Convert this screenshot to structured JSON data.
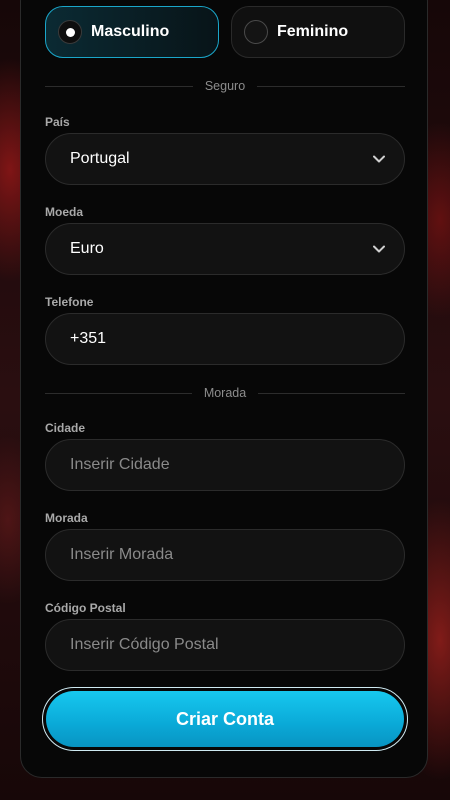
{
  "gender": {
    "male_label": "Masculino",
    "female_label": "Feminino",
    "selected": "Masculino"
  },
  "sections": {
    "insurance": "Seguro",
    "address": "Morada"
  },
  "fields": {
    "country": {
      "label": "País",
      "value": "Portugal"
    },
    "currency": {
      "label": "Moeda",
      "value": "Euro"
    },
    "phone": {
      "label": "Telefone",
      "value": "+351"
    },
    "city": {
      "label": "Cidade",
      "placeholder": "Inserir Cidade"
    },
    "street": {
      "label": "Morada",
      "placeholder": "Inserir Morada"
    },
    "postal_code": {
      "label": "Código Postal",
      "placeholder": "Inserir Código Postal"
    }
  },
  "submit_label": "Criar Conta",
  "colors": {
    "accent": "#0fb8e4",
    "panel": "#070707",
    "field_bg": "#121212"
  }
}
